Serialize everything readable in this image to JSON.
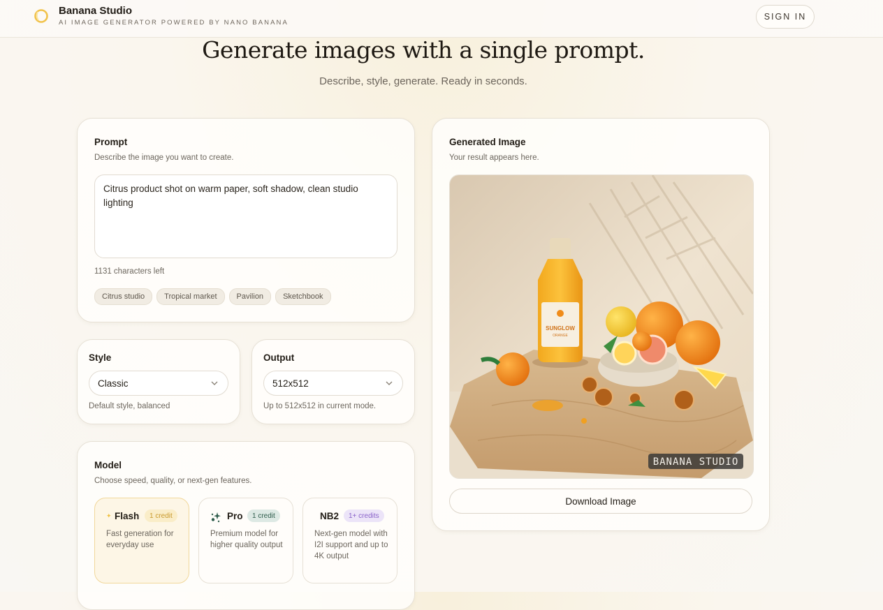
{
  "header": {
    "brand_title": "Banana Studio",
    "brand_subtitle": "AI IMAGE GENERATOR POWERED BY NANO BANANA",
    "sign_in": "SIGN IN"
  },
  "hero": {
    "title": "Generate images with a single prompt.",
    "subtitle": "Describe, style, generate. Ready in seconds."
  },
  "prompt": {
    "title": "Prompt",
    "description": "Describe the image you want to create.",
    "value": "Citrus product shot on warm paper, soft shadow, clean studio lighting",
    "chars_left": "1131 characters left",
    "suggestions": [
      "Citrus studio",
      "Tropical market",
      "Pavilion",
      "Sketchbook"
    ]
  },
  "style": {
    "title": "Style",
    "selected": "Classic",
    "helper": "Default style, balanced"
  },
  "output": {
    "title": "Output",
    "selected": "512x512",
    "helper": "Up to 512x512 in current mode."
  },
  "model": {
    "title": "Model",
    "description": "Choose speed, quality, or next-gen features.",
    "options": [
      {
        "name": "Flash",
        "badge": "1 credit",
        "description": "Fast generation for everyday use",
        "icon": "spark-icon",
        "selected": true
      },
      {
        "name": "Pro",
        "badge": "1 credit",
        "description": "Premium model for higher quality output",
        "icon": "sparkles-icon",
        "selected": false
      },
      {
        "name": "NB2",
        "badge": "1+ credits",
        "description": "Next-gen model with I2I support and up to 4K output",
        "icon": "",
        "selected": false
      }
    ]
  },
  "result": {
    "title": "Generated Image",
    "description": "Your result appears here.",
    "bottle_label": "SUNGLOW",
    "bottle_sublabel": "ORANGE",
    "watermark": "BANANA STUDIO",
    "download": "Download Image"
  },
  "colors": {
    "accent": "#f0c040",
    "selected_bg": "#fdf6e6",
    "flash_badge_bg": "#faedc8",
    "pro_badge_bg": "#dde9e4",
    "nb2_badge_bg": "#ece4f8"
  }
}
